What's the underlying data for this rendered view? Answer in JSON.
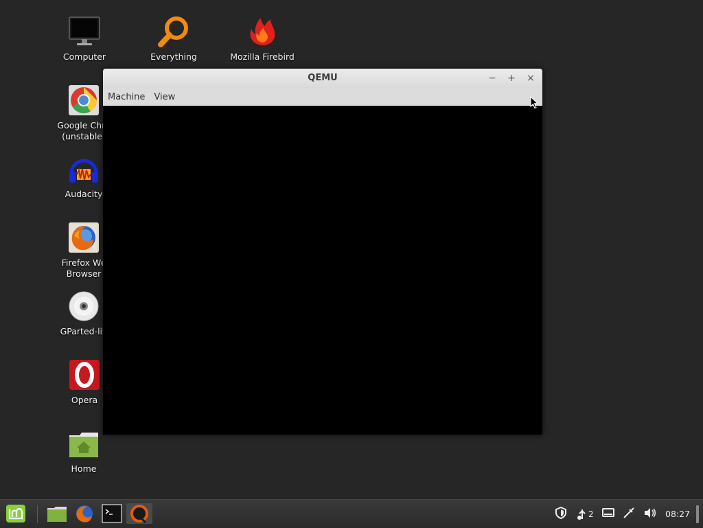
{
  "desktop": {
    "icons": [
      {
        "name": "Computer"
      },
      {
        "name": "Everything"
      },
      {
        "name": "Mozilla Firebird"
      },
      {
        "name": "Google Chro\n(unstable)"
      },
      {
        "name": "Audacity"
      },
      {
        "name": "Firefox We\nBrowser"
      },
      {
        "name": "GParted-liv"
      },
      {
        "name": "Opera"
      },
      {
        "name": "Home"
      }
    ]
  },
  "window": {
    "title": "QEMU",
    "menu": [
      "Machine",
      "View"
    ],
    "buttons": {
      "minimize": "−",
      "maximize": "+",
      "close": "×"
    }
  },
  "taskbar": {
    "launchers": [
      "mint-menu-icon",
      "files-icon",
      "firefox-icon",
      "terminal-icon",
      "qemu-icon"
    ],
    "tray": {
      "notification_count": "2",
      "clock": "08:27"
    }
  },
  "colors": {
    "desktop_bg": "#262626",
    "panel_bg": "#2f2f2f",
    "window_screen": "#000000"
  }
}
